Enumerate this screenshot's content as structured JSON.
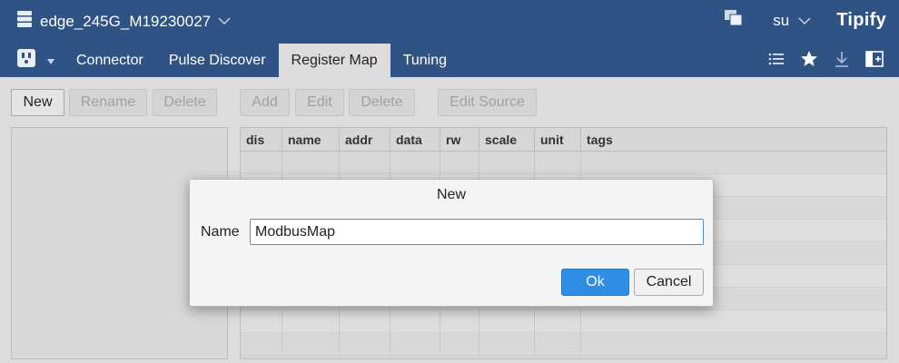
{
  "header": {
    "device_name": "edge_245G_M19230027",
    "user": "su",
    "brand": "Tipify"
  },
  "nav": {
    "tabs": [
      {
        "label": "Connector",
        "active": false
      },
      {
        "label": "Pulse Discover",
        "active": false
      },
      {
        "label": "Register Map",
        "active": true
      },
      {
        "label": "Tuning",
        "active": false
      }
    ]
  },
  "toolbar": {
    "new_label": "New",
    "rename_label": "Rename",
    "delete_label": "Delete",
    "add_label": "Add",
    "edit_label": "Edit",
    "delete2_label": "Delete",
    "edit_source_label": "Edit Source"
  },
  "table": {
    "columns": [
      "dis",
      "name",
      "addr",
      "data",
      "rw",
      "scale",
      "unit",
      "tags"
    ]
  },
  "dialog": {
    "title": "New",
    "name_label": "Name",
    "name_value": "ModbusMap",
    "ok_label": "Ok",
    "cancel_label": "Cancel"
  },
  "colors": {
    "header_bg": "#2f5384",
    "primary_button": "#2e8de4",
    "input_focus": "#4a90d9"
  },
  "icons": {
    "device": "server-stack-icon",
    "windows": "windows-icon",
    "plug": "plug-icon",
    "list": "list-icon",
    "star": "star-icon",
    "download": "download-icon",
    "panel": "panel-add-icon"
  }
}
